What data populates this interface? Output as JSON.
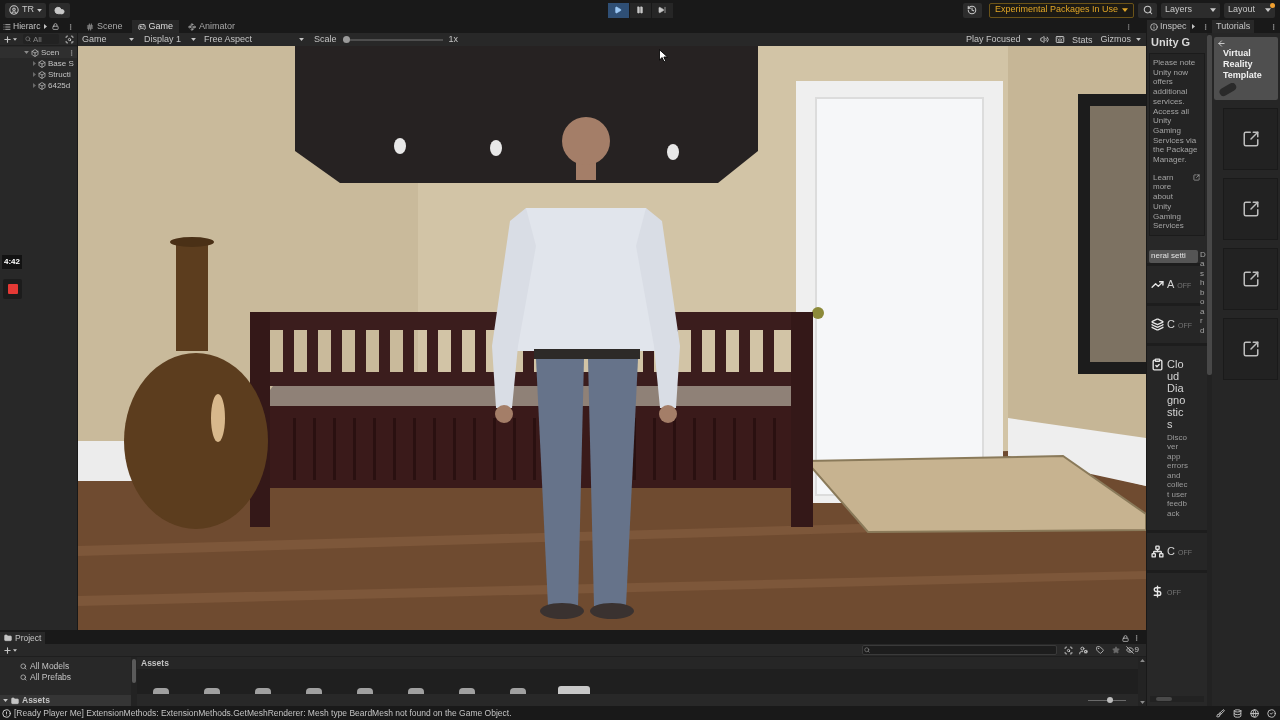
{
  "toolbar": {
    "account": "TR",
    "play_controls": [
      {
        "on": true
      },
      {
        "on": false
      },
      {
        "on": false
      }
    ],
    "packages_notice": "Experimental Packages In Use",
    "layers": "Layers",
    "layout": "Layout"
  },
  "hierarchy": {
    "tab": "Hierarc",
    "search_placeholder": "All",
    "tree": [
      {
        "label": "Scen",
        "expanded": true,
        "children": [
          {
            "label": "Base S",
            "expanded": false
          },
          {
            "label": "Structi",
            "expanded": false
          },
          {
            "label": "6425d",
            "expanded": false
          }
        ]
      }
    ]
  },
  "recorder": {
    "time": "4:42"
  },
  "view_tabs": [
    {
      "label": "Scene",
      "selected": false
    },
    {
      "label": "Game",
      "selected": true
    },
    {
      "label": "Animator",
      "selected": false
    }
  ],
  "game_toolbar": {
    "view": "Game",
    "display": "Display 1",
    "aspect": "Free Aspect",
    "scale_label": "Scale",
    "scale": {
      "level": 0,
      "reading": "1x"
    },
    "play_mode": "Play Focused",
    "stats": "Stats",
    "gizmos": "Gizmos"
  },
  "inspector": {
    "tab": "Inspec",
    "title": "Unity G",
    "notice": "Please note Unity now offers additional services. Access all Unity Gaming Services via the Package Manager.",
    "link": "Learn more about Unity Gaming Services",
    "settings_button": "neral setti",
    "dashboard": "Dashboard",
    "services": [
      {
        "name": "A",
        "status": "OFF"
      },
      {
        "name": "C",
        "status": "OFF"
      },
      {
        "name": "Cloud Diagnostics",
        "description": "Discover app errors and collect user feedback"
      },
      {
        "name": "C",
        "status": "OFF"
      },
      {
        "status": "OFF"
      }
    ]
  },
  "tutorials": {
    "tab": "Tutorials",
    "template_card": {
      "title": "Virtual Reality Template"
    }
  },
  "project": {
    "tab": "Project",
    "hidden_count": "9",
    "favorites": [
      "All Models",
      "All Prefabs"
    ],
    "assets_folder": {
      "label": "Assets",
      "expanded": true
    },
    "breadcrumb": "Assets",
    "thumbnail_size": {
      "level": 0.6
    }
  },
  "status_bar": {
    "message": "[Ready Player Me] ExtensionMethods: ExtensionMethods.GetMeshRenderer: Mesh type BeardMesh not found on the Game Object."
  }
}
